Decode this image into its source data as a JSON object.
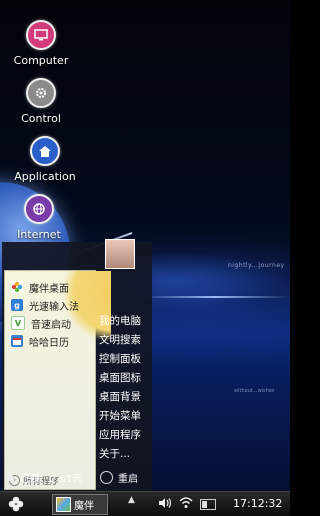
{
  "desktop": {
    "icons": [
      {
        "label": "Computer",
        "icon": "monitor-icon",
        "color": "#d23a7a"
      },
      {
        "label": "Control",
        "icon": "gear-icon",
        "color": "#8a8a8a"
      },
      {
        "label": "Application",
        "icon": "house-icon",
        "color": "#2a5fc9"
      },
      {
        "label": "Internet",
        "icon": "globe-icon",
        "color": "#7a3aa8"
      }
    ],
    "watermark_top": "nightly...journey",
    "watermark_bottom": "without...wishes"
  },
  "start_menu": {
    "apps": [
      {
        "label": "魔伴桌面",
        "icon": "flower-icon"
      },
      {
        "label": "光速输入法",
        "icon": "keyboard-g-icon"
      },
      {
        "label": "音速启动",
        "icon": "v-launcher-icon"
      },
      {
        "label": "哈哈日历",
        "icon": "calendar-icon"
      }
    ],
    "all_programs": "所有程序",
    "right_menu": [
      "我的电脑",
      "文明搜索",
      "控制面板",
      "桌面图标",
      "桌面背景",
      "开始菜单",
      "应用程序",
      "关于..."
    ],
    "earnings": "已赚：2.61元",
    "reboot": "重启"
  },
  "taskbar": {
    "task_label": "魔伴",
    "clock": "17:12:32"
  },
  "colors": {
    "menu_bg": "#12161f",
    "menu_left_bg": "#f3f2de",
    "accent_sun": "#f3cf63"
  }
}
